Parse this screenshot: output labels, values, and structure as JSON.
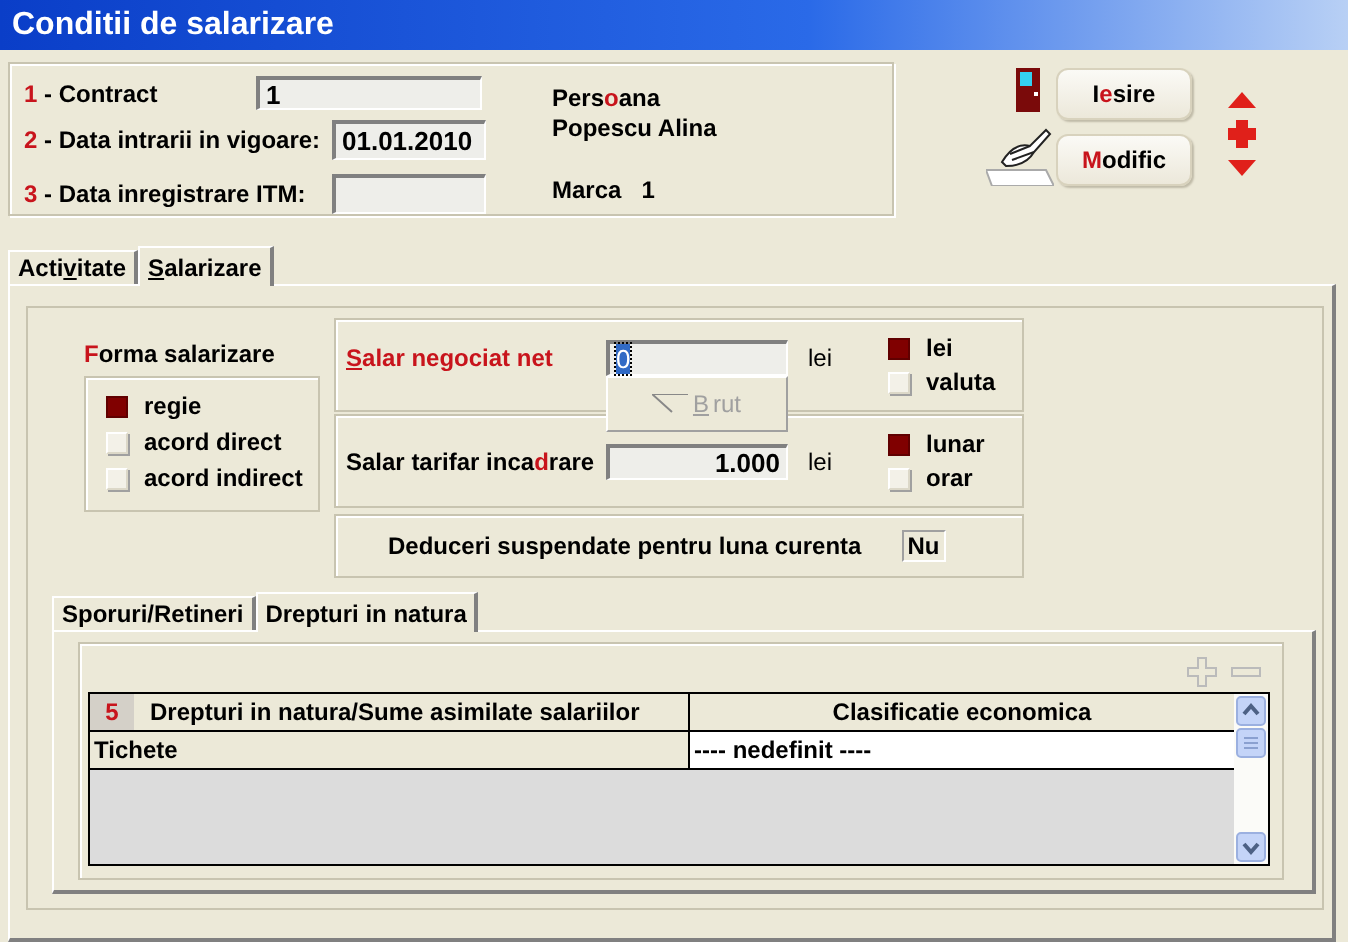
{
  "window": {
    "title": "Conditii de salarizare"
  },
  "header_fields": [
    {
      "number": "1",
      "label": " - Contract",
      "value": "1"
    },
    {
      "number": "2",
      "label": " - Data intrarii in vigoare:",
      "value": "01.01.2010"
    },
    {
      "number": "3",
      "label": " - Data inregistrare ITM:"
    }
  ],
  "person": {
    "caption": [
      {
        "text": "Pers",
        "kind": "plain"
      },
      {
        "text": "o",
        "kind": "red"
      },
      {
        "text": "ana",
        "kind": "plain"
      }
    ],
    "name": "Popescu Alina",
    "marca_label": "Marca",
    "marca_value": "1"
  },
  "buttons": [
    {
      "kind": "exit",
      "label": [
        {
          "text": "I",
          "kind": "plain"
        },
        {
          "text": "e",
          "kind": "red"
        },
        {
          "text": "sire",
          "kind": "plain"
        }
      ]
    },
    {
      "kind": "edit",
      "label": [
        {
          "text": "M",
          "kind": "red"
        },
        {
          "text": "odific",
          "kind": "plain"
        }
      ]
    }
  ],
  "tabs": [
    {
      "label": [
        {
          "text": "Acti",
          "kind": "plain"
        },
        {
          "text": "v",
          "kind": "underline"
        },
        {
          "text": "itate",
          "kind": "plain"
        }
      ],
      "selected": false
    },
    {
      "label": [
        {
          "text": "S",
          "kind": "underline"
        },
        {
          "text": "alarizare",
          "kind": "plain"
        }
      ],
      "selected": true
    }
  ],
  "forma_salarizare": {
    "title": [
      {
        "text": "F",
        "kind": "red"
      },
      {
        "text": "orma salarizare",
        "kind": "plain"
      }
    ],
    "options": [
      {
        "label": "regie",
        "selected": true
      },
      {
        "label": "acord direct",
        "selected": false
      },
      {
        "label": "acord indirect",
        "selected": false
      }
    ]
  },
  "salar_negociat": {
    "label": [
      {
        "text": "S",
        "kind": "red-underline"
      },
      {
        "text": "alar negociat net",
        "kind": "red"
      }
    ],
    "value": "0",
    "unit": "lei",
    "brut_button": {
      "label": [
        {
          "text": "B",
          "kind": "underline"
        },
        {
          "text": "rut",
          "kind": "plain"
        }
      ],
      "disabled": true
    },
    "options": [
      {
        "label": "lei",
        "selected": true
      },
      {
        "label": "valuta",
        "selected": false
      }
    ]
  },
  "salar_tarifar": {
    "label": [
      {
        "text": "Salar tarifar inca",
        "kind": "plain"
      },
      {
        "text": "d",
        "kind": "red"
      },
      {
        "text": "rare",
        "kind": "plain"
      }
    ],
    "value": "1.000",
    "unit": "lei",
    "options": [
      {
        "label": "lunar",
        "selected": true
      },
      {
        "label": "orar",
        "selected": false
      }
    ]
  },
  "deduceri": {
    "label": "Deduceri suspendate pentru luna curenta",
    "value": "Nu"
  },
  "subtabs": [
    {
      "label": "Sporuri/Retineri",
      "selected": false
    },
    {
      "label": "Drepturi in natura",
      "selected": true
    }
  ],
  "table": {
    "number": "5",
    "columns": [
      "Drepturi in natura/Sume asimilate salariilor",
      "Clasificatie economica"
    ],
    "rows": [
      [
        "Tichete",
        "---- nedefinit ----"
      ]
    ]
  }
}
